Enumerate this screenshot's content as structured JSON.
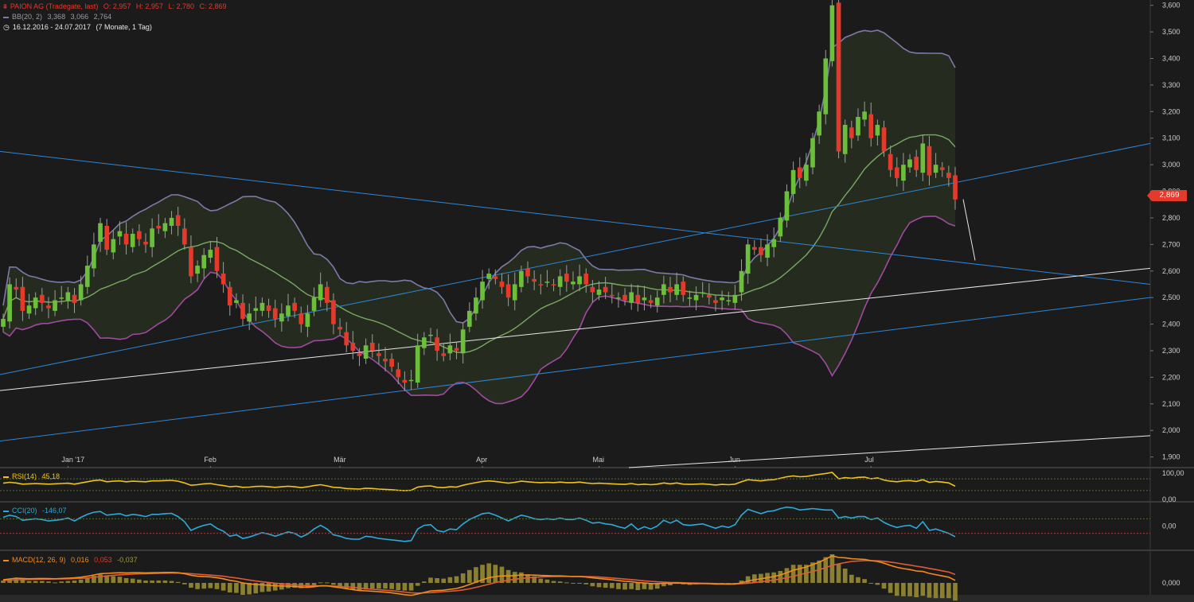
{
  "header": {
    "symbol": "PAION AG (Tradegate, last)",
    "ohlc": {
      "o": "O: 2,957",
      "h": "H: 2,957",
      "l": "L: 2,780",
      "c": "C: 2,869"
    },
    "bb_label": "BB(20, 2)",
    "bb_values": [
      "3,368",
      "3,066",
      "2,764"
    ],
    "range": "16.12.2016 - 24.07.2017",
    "range_note": "(7 Monate, 1 Tag)"
  },
  "last_price_tag": "2,869",
  "indicators": {
    "rsi": {
      "label": "RSI(14)",
      "value": "45,18",
      "axis": [
        "100,00",
        "0,00"
      ]
    },
    "cci": {
      "label": "CCI(20)",
      "value": "-146,07",
      "axis": [
        "0,00"
      ]
    },
    "macd": {
      "label": "MACD(12, 26, 9)",
      "values": [
        "0,016",
        "0,053",
        "-0,037"
      ],
      "axis": [
        "0,000"
      ]
    }
  },
  "colors": {
    "up": "#6cbf3a",
    "down": "#e33a2c",
    "bb_band": "#7d7aa8",
    "bb_mid": "#7aa860",
    "bb_lower": "#a04aa0",
    "trend_blue": "#2f86d6",
    "trend_white": "#e8e8e8",
    "rsi": "#f0c419",
    "cci": "#2fa9d8",
    "macd": "#f28c1a",
    "signal": "#e05a3a",
    "hist": "#8a8030"
  },
  "chart_data": {
    "type": "candlestick",
    "ylim": [
      1.86,
      3.62
    ],
    "yticks": [
      "1,900",
      "2,000",
      "2,100",
      "2,200",
      "2,300",
      "2,400",
      "2,500",
      "2,600",
      "2,700",
      "2,800",
      "2,900",
      "3,000",
      "3,100",
      "3,200",
      "3,300",
      "3,400",
      "3,500",
      "3,600"
    ],
    "x_labels": [
      {
        "label": "Jan '17",
        "i": 10
      },
      {
        "label": "Feb",
        "i": 32
      },
      {
        "label": "Mär",
        "i": 52
      },
      {
        "label": "Apr",
        "i": 74
      },
      {
        "label": "Mai",
        "i": 92
      },
      {
        "label": "Jun",
        "i": 113
      },
      {
        "label": "Jul",
        "i": 134
      }
    ],
    "closes": [
      2.42,
      2.55,
      2.53,
      2.45,
      2.47,
      2.5,
      2.48,
      2.46,
      2.49,
      2.5,
      2.52,
      2.48,
      2.55,
      2.62,
      2.7,
      2.78,
      2.68,
      2.72,
      2.75,
      2.7,
      2.74,
      2.72,
      2.7,
      2.76,
      2.76,
      2.78,
      2.8,
      2.77,
      2.7,
      2.58,
      2.62,
      2.66,
      2.68,
      2.6,
      2.55,
      2.47,
      2.49,
      2.42,
      2.44,
      2.46,
      2.48,
      2.45,
      2.42,
      2.44,
      2.47,
      2.45,
      2.4,
      2.44,
      2.5,
      2.55,
      2.48,
      2.4,
      2.38,
      2.32,
      2.3,
      2.28,
      2.32,
      2.3,
      2.28,
      2.26,
      2.24,
      2.2,
      2.18,
      2.19,
      2.32,
      2.35,
      2.36,
      2.3,
      2.28,
      2.32,
      2.3,
      2.38,
      2.45,
      2.5,
      2.56,
      2.59,
      2.57,
      2.54,
      2.5,
      2.55,
      2.6,
      2.58,
      2.56,
      2.55,
      2.56,
      2.55,
      2.58,
      2.56,
      2.56,
      2.58,
      2.55,
      2.52,
      2.53,
      2.52,
      2.51,
      2.5,
      2.49,
      2.52,
      2.48,
      2.5,
      2.48,
      2.5,
      2.55,
      2.52,
      2.55,
      2.51,
      2.5,
      2.51,
      2.52,
      2.5,
      2.48,
      2.5,
      2.49,
      2.51,
      2.6,
      2.7,
      2.68,
      2.66,
      2.7,
      2.72,
      2.8,
      2.9,
      2.98,
      2.95,
      3.0,
      3.1,
      3.2,
      3.4,
      3.6,
      3.05,
      3.15,
      3.1,
      3.18,
      3.2,
      3.1,
      3.15,
      3.05,
      2.98,
      2.95,
      3.0,
      3.02,
      2.98,
      3.08,
      2.96,
      3.0,
      2.98,
      2.95,
      2.869
    ],
    "rsi": [
      55,
      58,
      56,
      52,
      53,
      54,
      53,
      52,
      53,
      54,
      55,
      52,
      56,
      60,
      64,
      66,
      60,
      62,
      63,
      60,
      62,
      61,
      60,
      63,
      63,
      64,
      65,
      62,
      56,
      48,
      50,
      53,
      54,
      50,
      47,
      43,
      45,
      41,
      42,
      44,
      45,
      43,
      41,
      43,
      45,
      43,
      40,
      43,
      47,
      50,
      46,
      41,
      40,
      37,
      36,
      35,
      38,
      37,
      35,
      34,
      33,
      31,
      30,
      31,
      42,
      45,
      46,
      41,
      40,
      43,
      42,
      48,
      53,
      57,
      61,
      63,
      61,
      58,
      55,
      58,
      62,
      60,
      58,
      57,
      58,
      57,
      59,
      57,
      57,
      59,
      56,
      54,
      55,
      54,
      53,
      52,
      51,
      54,
      50,
      52,
      50,
      52,
      56,
      53,
      56,
      52,
      51,
      52,
      53,
      51,
      49,
      51,
      50,
      52,
      60,
      67,
      65,
      63,
      66,
      67,
      72,
      77,
      80,
      77,
      78,
      82,
      85,
      88,
      92,
      70,
      74,
      72,
      75,
      76,
      70,
      73,
      66,
      62,
      60,
      63,
      64,
      61,
      67,
      58,
      61,
      59,
      56,
      45
    ],
    "cci": [
      120,
      150,
      130,
      80,
      90,
      100,
      90,
      70,
      80,
      90,
      110,
      70,
      120,
      160,
      190,
      200,
      150,
      160,
      170,
      140,
      160,
      150,
      130,
      160,
      160,
      170,
      175,
      130,
      60,
      -60,
      -20,
      10,
      30,
      -30,
      -70,
      -140,
      -120,
      -170,
      -150,
      -120,
      -90,
      -110,
      -140,
      -110,
      -80,
      -100,
      -150,
      -110,
      -40,
      10,
      -40,
      -120,
      -140,
      -170,
      -180,
      -180,
      -140,
      -150,
      -170,
      -180,
      -190,
      -200,
      -210,
      -200,
      -40,
      10,
      20,
      -60,
      -80,
      -40,
      -50,
      30,
      90,
      130,
      170,
      180,
      150,
      110,
      70,
      110,
      150,
      130,
      100,
      90,
      100,
      90,
      110,
      90,
      90,
      110,
      80,
      40,
      50,
      30,
      20,
      -10,
      -30,
      30,
      -50,
      -10,
      -40,
      0,
      80,
      40,
      80,
      20,
      10,
      20,
      30,
      0,
      -30,
      0,
      -20,
      20,
      150,
      230,
      200,
      170,
      200,
      210,
      240,
      260,
      250,
      220,
      230,
      240,
      230,
      220,
      220,
      110,
      130,
      110,
      130,
      130,
      90,
      110,
      50,
      10,
      -20,
      0,
      10,
      -30,
      60,
      -60,
      -40,
      -70,
      -100,
      -146
    ],
    "macd": [
      0.02,
      0.025,
      0.03,
      0.028,
      0.026,
      0.027,
      0.028,
      0.027,
      0.026,
      0.028,
      0.03,
      0.032,
      0.036,
      0.042,
      0.05,
      0.058,
      0.06,
      0.062,
      0.064,
      0.063,
      0.064,
      0.064,
      0.063,
      0.064,
      0.065,
      0.066,
      0.066,
      0.064,
      0.058,
      0.048,
      0.042,
      0.04,
      0.038,
      0.033,
      0.026,
      0.016,
      0.01,
      0.0,
      -0.006,
      -0.01,
      -0.012,
      -0.015,
      -0.018,
      -0.02,
      -0.02,
      -0.022,
      -0.026,
      -0.027,
      -0.024,
      -0.018,
      -0.018,
      -0.024,
      -0.03,
      -0.036,
      -0.042,
      -0.048,
      -0.05,
      -0.052,
      -0.055,
      -0.058,
      -0.062,
      -0.068,
      -0.074,
      -0.078,
      -0.07,
      -0.06,
      -0.05,
      -0.048,
      -0.046,
      -0.04,
      -0.035,
      -0.024,
      -0.01,
      0.005,
      0.02,
      0.033,
      0.04,
      0.044,
      0.044,
      0.046,
      0.05,
      0.05,
      0.049,
      0.047,
      0.046,
      0.044,
      0.044,
      0.042,
      0.04,
      0.04,
      0.037,
      0.032,
      0.028,
      0.024,
      0.02,
      0.015,
      0.01,
      0.008,
      0.002,
      0.0,
      -0.004,
      -0.005,
      -0.002,
      -0.002,
      0.0,
      -0.002,
      -0.004,
      -0.004,
      -0.004,
      -0.005,
      -0.007,
      -0.007,
      -0.008,
      -0.007,
      0.0,
      0.012,
      0.02,
      0.026,
      0.033,
      0.04,
      0.05,
      0.064,
      0.08,
      0.09,
      0.1,
      0.115,
      0.13,
      0.15,
      0.17,
      0.16,
      0.158,
      0.152,
      0.15,
      0.148,
      0.14,
      0.135,
      0.124,
      0.11,
      0.098,
      0.09,
      0.084,
      0.075,
      0.072,
      0.06,
      0.052,
      0.044,
      0.036,
      0.016
    ],
    "signal": [
      0.015,
      0.017,
      0.019,
      0.021,
      0.022,
      0.023,
      0.024,
      0.024,
      0.025,
      0.025,
      0.026,
      0.027,
      0.029,
      0.031,
      0.035,
      0.04,
      0.044,
      0.048,
      0.051,
      0.053,
      0.055,
      0.057,
      0.058,
      0.059,
      0.06,
      0.061,
      0.062,
      0.062,
      0.061,
      0.058,
      0.055,
      0.052,
      0.049,
      0.046,
      0.042,
      0.036,
      0.031,
      0.025,
      0.018,
      0.012,
      0.007,
      0.003,
      -0.002,
      -0.006,
      -0.009,
      -0.012,
      -0.015,
      -0.018,
      -0.019,
      -0.019,
      -0.019,
      -0.02,
      -0.022,
      -0.025,
      -0.028,
      -0.032,
      -0.036,
      -0.04,
      -0.043,
      -0.046,
      -0.049,
      -0.053,
      -0.058,
      -0.062,
      -0.064,
      -0.063,
      -0.061,
      -0.058,
      -0.055,
      -0.052,
      -0.049,
      -0.044,
      -0.037,
      -0.028,
      -0.018,
      -0.008,
      0.002,
      0.01,
      0.017,
      0.023,
      0.028,
      0.032,
      0.035,
      0.038,
      0.039,
      0.04,
      0.041,
      0.041,
      0.041,
      0.041,
      0.04,
      0.039,
      0.037,
      0.034,
      0.031,
      0.028,
      0.024,
      0.021,
      0.017,
      0.013,
      0.01,
      0.007,
      0.005,
      0.003,
      0.002,
      0.001,
      0.0,
      -0.001,
      -0.002,
      -0.003,
      -0.004,
      -0.005,
      -0.006,
      -0.006,
      -0.005,
      -0.002,
      0.002,
      0.007,
      0.012,
      0.018,
      0.025,
      0.033,
      0.042,
      0.052,
      0.062,
      0.072,
      0.083,
      0.096,
      0.11,
      0.12,
      0.128,
      0.135,
      0.138,
      0.14,
      0.14,
      0.139,
      0.136,
      0.131,
      0.125,
      0.118,
      0.112,
      0.105,
      0.099,
      0.091,
      0.084,
      0.076,
      0.068,
      0.053
    ]
  }
}
